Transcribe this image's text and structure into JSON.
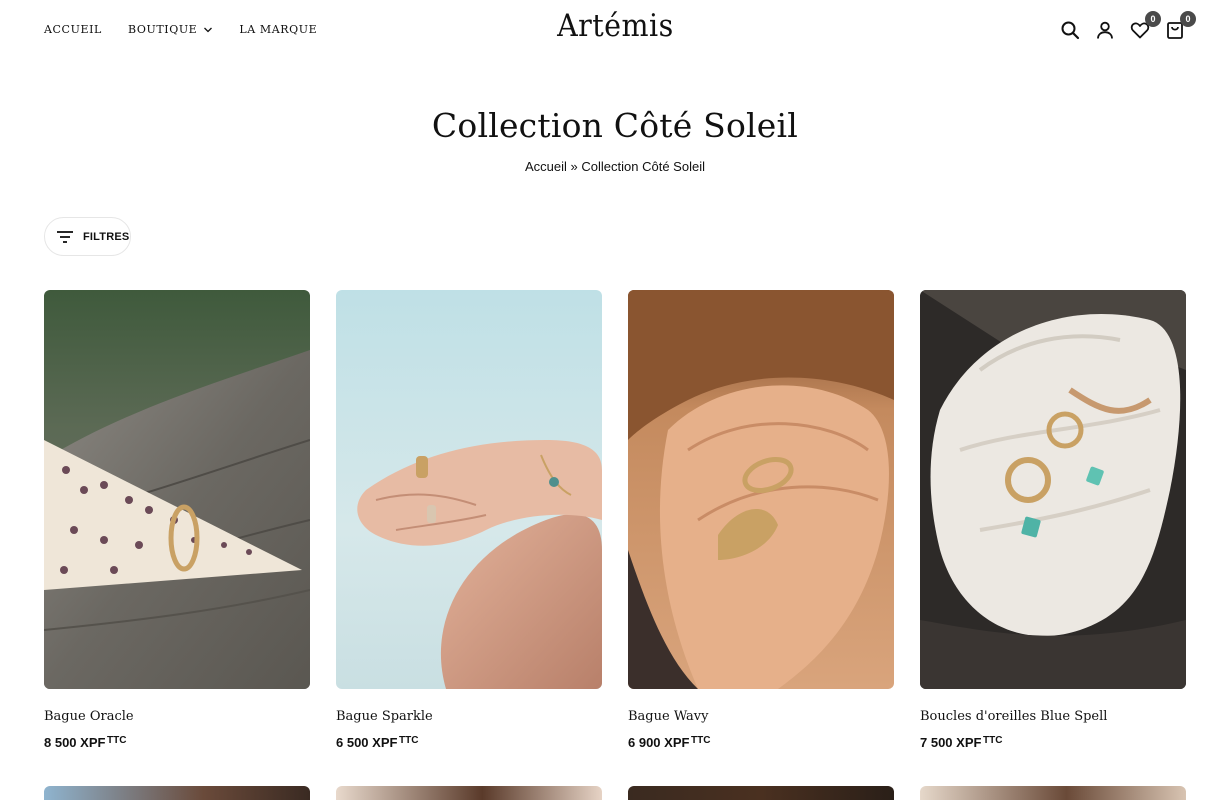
{
  "nav": {
    "items": [
      {
        "label": "ACCUEIL"
      },
      {
        "label": "BOUTIQUE"
      },
      {
        "label": "LA MARQUE"
      }
    ]
  },
  "logo": "Artémis",
  "header_icons": {
    "search": "search-icon",
    "account": "user-icon",
    "wishlist": "heart-icon",
    "wishlist_count": "0",
    "cart": "bag-icon",
    "cart_count": "0"
  },
  "page": {
    "title": "Collection Côté Soleil",
    "breadcrumb": {
      "home": "Accueil",
      "separator": "»",
      "current": "Collection Côté Soleil"
    }
  },
  "filters": {
    "label": "FILTRES",
    "icon": "filter-icon"
  },
  "products": [
    {
      "name": "Bague Oracle",
      "price": "8 500 XPF",
      "tax": "TTC"
    },
    {
      "name": "Bague Sparkle",
      "price": "6 500 XPF",
      "tax": "TTC"
    },
    {
      "name": "Bague Wavy",
      "price": "6 900 XPF",
      "tax": "TTC"
    },
    {
      "name": "Boucles d'oreilles Blue Spell",
      "price": "7 500 XPF",
      "tax": "TTC"
    }
  ],
  "colors": {
    "text": "#111111",
    "badge": "#4a4a4a",
    "border": "#e6e6e6"
  }
}
